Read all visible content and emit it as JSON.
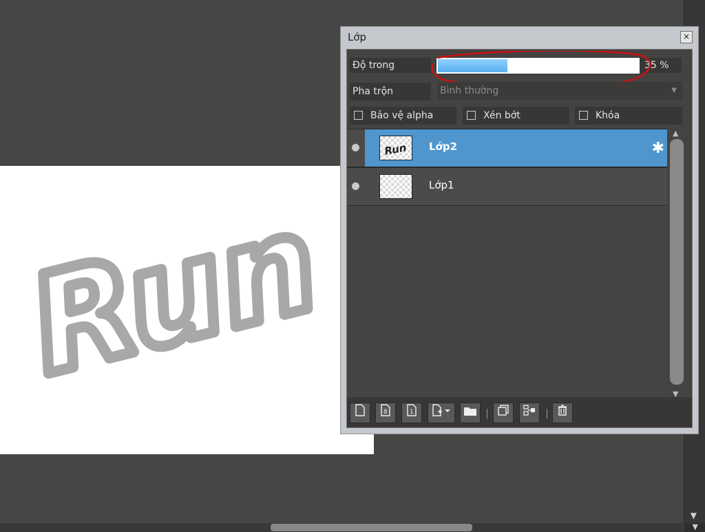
{
  "canvas": {
    "text": "Run"
  },
  "panel": {
    "title": "Lớp",
    "close_label": "×",
    "opacity": {
      "label": "Độ trong",
      "value": 35,
      "value_text": "35 %"
    },
    "blend": {
      "label": "Pha trộn",
      "value": "Bình thường"
    },
    "checkboxes": [
      {
        "label": "Bảo vệ alpha",
        "checked": false
      },
      {
        "label": "Xén bớt",
        "checked": false
      },
      {
        "label": "Khóa",
        "checked": false
      }
    ],
    "layers": [
      {
        "name": "Lớp2",
        "selected": true,
        "thumb_text": "Run"
      },
      {
        "name": "Lớp1",
        "selected": false,
        "thumb_text": ""
      }
    ],
    "toolbar_icons": [
      "new-layer-icon",
      "8bit-layer-icon",
      "1bit-layer-icon",
      "add-layer-dropdown-icon",
      "folder-icon",
      "duplicate-layer-icon",
      "merge-layer-icon",
      "delete-layer-icon"
    ]
  },
  "colors": {
    "accent_selected": "#4f96cf",
    "opacity_fill": "#5ab0ef",
    "annotation": "#cc1111"
  }
}
